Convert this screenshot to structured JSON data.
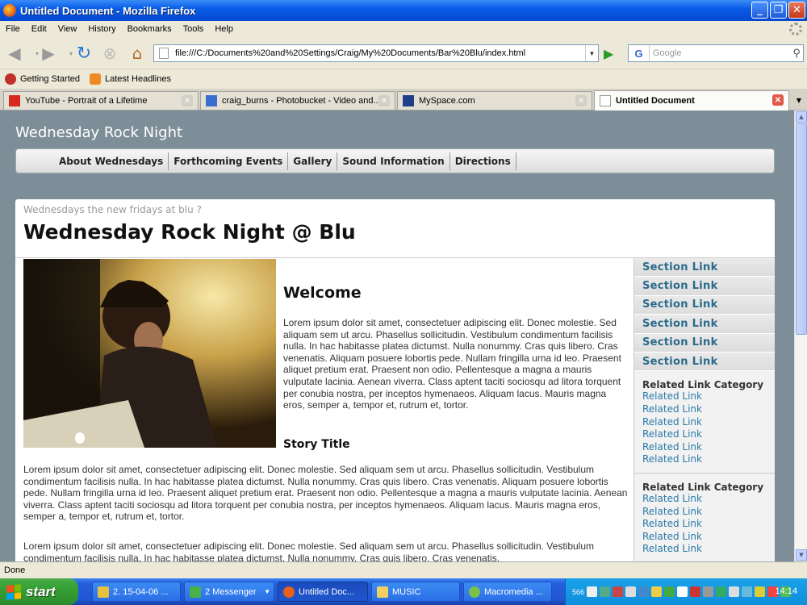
{
  "window": {
    "title": "Untitled Document - Mozilla Firefox"
  },
  "menubar": {
    "items": [
      "File",
      "Edit",
      "View",
      "History",
      "Bookmarks",
      "Tools",
      "Help"
    ]
  },
  "toolbar": {
    "url": "file:///C:/Documents%20and%20Settings/Craig/My%20Documents/Bar%20Blu/index.html",
    "search_placeholder": "Google",
    "search_engine": "G"
  },
  "bookmarks": {
    "items": [
      "Getting Started",
      "Latest Headlines"
    ]
  },
  "tabs": [
    {
      "label": "YouTube - Portrait of a Lifetime",
      "active": false
    },
    {
      "label": "craig_burns - Photobucket - Video and...",
      "active": false
    },
    {
      "label": "MySpace.com",
      "active": false
    },
    {
      "label": "Untitled Document",
      "active": true
    }
  ],
  "page": {
    "site_title": "Wednesday Rock Night",
    "nav": [
      "About Wednesdays",
      "Forthcoming Events",
      "Gallery",
      "Sound Information",
      "Directions"
    ],
    "tagline": "Wednesdays the new fridays at blu ?",
    "title": "Wednesday Rock Night @ Blu",
    "welcome_heading": "Welcome",
    "welcome_text": "Lorem ipsum dolor sit amet, consectetuer adipiscing elit. Donec molestie. Sed aliquam sem ut arcu. Phasellus sollicitudin. Vestibulum condimentum facilisis nulla. In hac habitasse platea dictumst. Nulla nonummy. Cras quis libero. Cras venenatis. Aliquam posuere lobortis pede. Nullam fringilla urna id leo. Praesent aliquet pretium erat. Praesent non odio. Pellentesque a magna a mauris vulputate lacinia. Aenean viverra. Class aptent taciti sociosqu ad litora torquent per conubia nostra, per inceptos hymenaeos. Aliquam lacus. Mauris magna eros, semper a, tempor et, rutrum et, tortor.",
    "story_title": "Story Title",
    "story_text_1": "Lorem ipsum dolor sit amet, consectetuer adipiscing elit. Donec molestie. Sed aliquam sem ut arcu. Phasellus sollicitudin. Vestibulum condimentum facilisis nulla. In hac habitasse platea dictumst. Nulla nonummy. Cras quis libero. Cras venenatis. Aliquam posuere lobortis pede. Nullam fringilla urna id leo. Praesent aliquet pretium erat. Praesent non odio. Pellentesque a magna a mauris vulputate lacinia. Aenean viverra. Class aptent taciti sociosqu ad litora torquent per conubia nostra, per inceptos hymenaeos. Aliquam lacus. Mauris magna eros, semper a, tempor et, rutrum et, tortor.",
    "story_text_2": "Lorem ipsum dolor sit amet, consectetuer adipiscing elit. Donec molestie. Sed aliquam sem ut arcu. Phasellus sollicitudin. Vestibulum condimentum facilisis nulla. In hac habitasse platea dictumst. Nulla nonummy. Cras quis libero. Cras venenatis.",
    "section_links": [
      "Section Link",
      "Section Link",
      "Section Link",
      "Section Link",
      "Section Link",
      "Section Link"
    ],
    "related_categories": [
      {
        "title": "Related Link Category",
        "links": [
          "Related Link",
          "Related Link",
          "Related Link",
          "Related Link",
          "Related Link",
          "Related Link"
        ]
      },
      {
        "title": "Related Link Category",
        "links": [
          "Related Link",
          "Related Link",
          "Related Link",
          "Related Link",
          "Related Link"
        ]
      }
    ]
  },
  "status": {
    "text": "Done"
  },
  "taskbar": {
    "start_label": "start",
    "items": [
      {
        "label": "2. 15-04-06 ..."
      },
      {
        "label": "2 Messenger"
      },
      {
        "label": "Untitled Doc..."
      },
      {
        "label": "MUSIC"
      },
      {
        "label": "Macromedia ..."
      }
    ],
    "clock": "14:14",
    "tray_badge": "566"
  },
  "colors": {
    "titlebar": "#0a5ce8",
    "page_bg": "#7e8e98",
    "link": "#2a7aa8",
    "section_link": "#2a6a8a"
  }
}
